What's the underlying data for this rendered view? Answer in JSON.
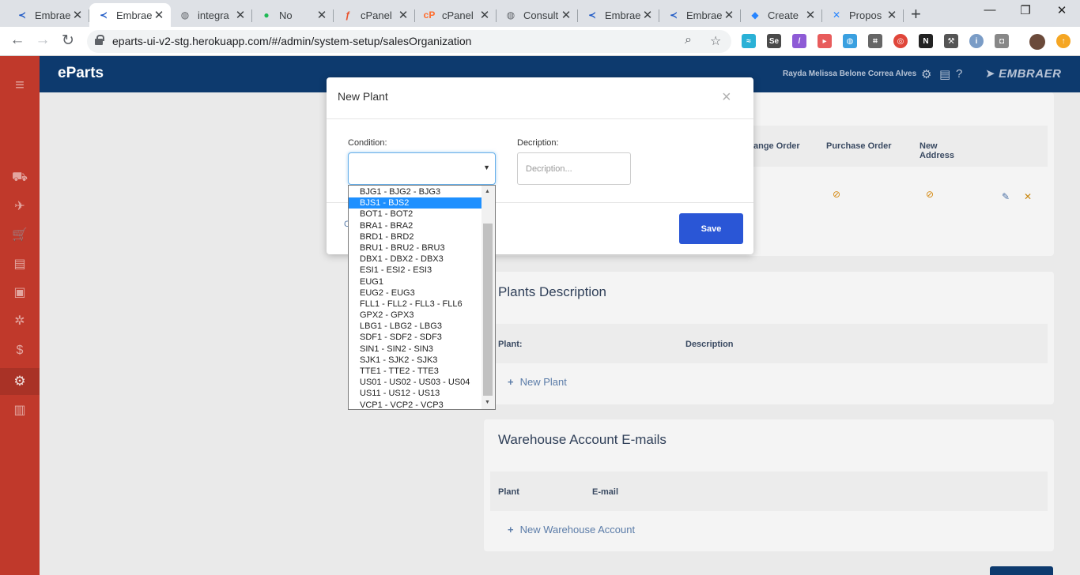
{
  "browser": {
    "tabs": [
      {
        "label": "Embrae",
        "icon": "embraer-icon",
        "color": "#1a56c4"
      },
      {
        "label": "Embrae",
        "icon": "embraer-icon",
        "color": "#1a56c4",
        "active": true
      },
      {
        "label": "integra",
        "icon": "globe-icon",
        "color": "#5f6368"
      },
      {
        "label": "No",
        "icon": "spotify-icon",
        "color": "#1db954"
      },
      {
        "label": "cPanel",
        "icon": "figma-icon",
        "color": "#e8542f"
      },
      {
        "label": "cPanel",
        "icon": "cpanel-icon",
        "color": "#ff6c2c"
      },
      {
        "label": "Consult",
        "icon": "globe-icon",
        "color": "#5f6368"
      },
      {
        "label": "Embrae",
        "icon": "embraer-icon",
        "color": "#1a56c4"
      },
      {
        "label": "Embrae",
        "icon": "embraer-icon",
        "color": "#1a56c4"
      },
      {
        "label": "Create",
        "icon": "jira-icon",
        "color": "#2684ff"
      },
      {
        "label": "Propos",
        "icon": "confluence-icon",
        "color": "#2684ff"
      }
    ],
    "new_tab": "+",
    "url": "eparts-ui-v2-stg.herokuapp.com/#/admin/system-setup/salesOrganization",
    "window": {
      "minimize": "—",
      "restore": "❐",
      "close": "✕"
    }
  },
  "app": {
    "brand": "eParts",
    "user_name": "Rayda Melissa Belone Correa Alves",
    "logo": "EMBRAER",
    "colors": {
      "sidebar": "#c0392b",
      "topnav": "#0d3a6e",
      "primary_button": "#2a56d6"
    }
  },
  "background": {
    "top_card": {
      "columns": [
        "ange Order",
        "Purchase Order",
        "New Address"
      ]
    },
    "plants_description": {
      "title": "Plants Description",
      "columns": [
        "Plant:",
        "Description"
      ],
      "new_link": "New Plant"
    },
    "warehouse": {
      "title": "Warehouse Account E-mails",
      "columns": [
        "Plant",
        "E-mail"
      ],
      "new_link": "New Warehouse Account"
    }
  },
  "modal": {
    "title": "New Plant",
    "close": "×",
    "condition_label": "Condition:",
    "condition_value": "",
    "description_label": "Decription:",
    "description_placeholder": "Decription...",
    "save_label": "Save",
    "cancel_peek": "C"
  },
  "dropdown": {
    "selected": "BJS1 - BJS2",
    "options": [
      "BJG1 - BJG2 - BJG3",
      "BJS1 - BJS2",
      "BOT1 - BOT2",
      "BRA1 - BRA2",
      "BRD1 - BRD2",
      "BRU1 - BRU2 - BRU3",
      "DBX1 - DBX2 - DBX3",
      "ESI1 - ESI2 - ESI3",
      "EUG1",
      "EUG2 - EUG3",
      "FLL1 - FLL2 - FLL3 - FLL6",
      "GPX2 - GPX3",
      "LBG1 - LBG2 - LBG3",
      "SDF1 - SDF2 - SDF3",
      "SIN1 - SIN2 - SIN3",
      "SJK1 - SJK2 - SJK3",
      "TTE1 - TTE2 - TTE3",
      "US01 - US02 - US03 - US04",
      "US11 - US12 - US13",
      "VCP1 - VCP2 - VCP3"
    ]
  }
}
